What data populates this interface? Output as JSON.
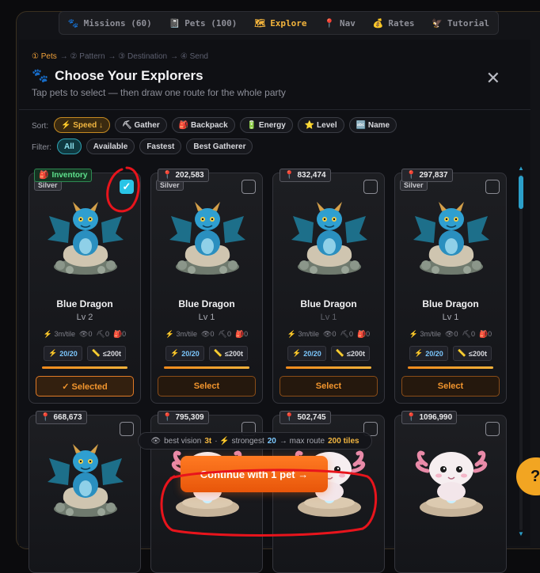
{
  "nav": {
    "items": [
      {
        "label": "Missions (60)",
        "icon": "🐾",
        "active": false
      },
      {
        "label": "Pets (100)",
        "icon": "📓",
        "active": false
      },
      {
        "label": "Explore",
        "icon": "🗺",
        "active": true
      },
      {
        "label": "Nav",
        "icon": "📍",
        "active": false
      },
      {
        "label": "Rates",
        "icon": "💰",
        "active": false
      },
      {
        "label": "Tutorial",
        "icon": "🦅",
        "active": false
      }
    ]
  },
  "steps": {
    "s1": "① Pets",
    "s2": "→ ② Pattern",
    "s3": "→ ③ Destination",
    "s4": "→ ④ Send"
  },
  "header": {
    "title": "Choose Your Explorers",
    "title_icon": "🐾",
    "subtitle": "Tap pets to select — then draw one route for the whole party",
    "close": "✕"
  },
  "sort": {
    "label": "Sort:",
    "options": [
      {
        "label": "⚡ Speed ↓",
        "active": true
      },
      {
        "label": "⛏ Gather",
        "active": false
      },
      {
        "label": "🎒 Backpack",
        "active": false
      },
      {
        "label": "🔋 Energy",
        "active": false
      },
      {
        "label": "⭐ Level",
        "active": false
      },
      {
        "label": "🔤 Name",
        "active": false
      }
    ]
  },
  "filter": {
    "label": "Filter:",
    "options": [
      {
        "label": "All",
        "active": true
      },
      {
        "label": "Available",
        "active": false
      },
      {
        "label": "Fastest",
        "active": false
      },
      {
        "label": "Best Gatherer",
        "active": false
      }
    ]
  },
  "pets_row1": [
    {
      "location": "Inventory",
      "is_inventory": true,
      "rank": "Silver",
      "name": "Blue Dragon",
      "level": "Lv 2",
      "speed": "3m/tile",
      "vision": "0",
      "gather": "0",
      "pack": "0",
      "energy": "20/20",
      "range": "≤200t",
      "energy_fill": 1.0,
      "button": "✓ Selected",
      "selected": true
    },
    {
      "location": "202,583",
      "is_inventory": false,
      "rank": "Silver",
      "name": "Blue Dragon",
      "level": "Lv 1",
      "speed": "3m/tile",
      "vision": "0",
      "gather": "0",
      "pack": "0",
      "energy": "20/20",
      "range": "≤200t",
      "energy_fill": 1.0,
      "button": "Select",
      "selected": false
    },
    {
      "location": "832,474",
      "is_inventory": false,
      "rank": "",
      "name": "Blue Dragon",
      "level": "Lv 1",
      "speed": "3m/tile",
      "vision": "0",
      "gather": "0",
      "pack": "0",
      "energy": "20/20",
      "range": "≤200t",
      "energy_fill": 1.0,
      "button": "Select",
      "selected": false
    },
    {
      "location": "297,837",
      "is_inventory": false,
      "rank": "Silver",
      "name": "Blue Dragon",
      "level": "Lv 1",
      "speed": "3m/tile",
      "vision": "0",
      "gather": "0",
      "pack": "0",
      "energy": "20/20",
      "range": "≤200t",
      "energy_fill": 1.0,
      "button": "Select",
      "selected": false
    }
  ],
  "pets_row2": [
    {
      "location": "668,673",
      "kind": "dragon"
    },
    {
      "location": "795,309",
      "kind": "axolotl"
    },
    {
      "location": "502,745",
      "kind": "axolotl"
    },
    {
      "location": "1096,990",
      "kind": "axolotl"
    }
  ],
  "summary": {
    "vision_label": "best vision",
    "vision_value": "3t",
    "strongest_label": "· ⚡ strongest",
    "strongest_value": "20",
    "route_label": "→ max route",
    "route_value": "200 tiles"
  },
  "cta": {
    "label": "Continue with 1 pet →"
  },
  "help": {
    "label": "?"
  },
  "colors": {
    "accent": "#f2952d",
    "selected_check": "#29c4e6",
    "cta": "#ff7a22",
    "annotation": "#e8141c"
  }
}
